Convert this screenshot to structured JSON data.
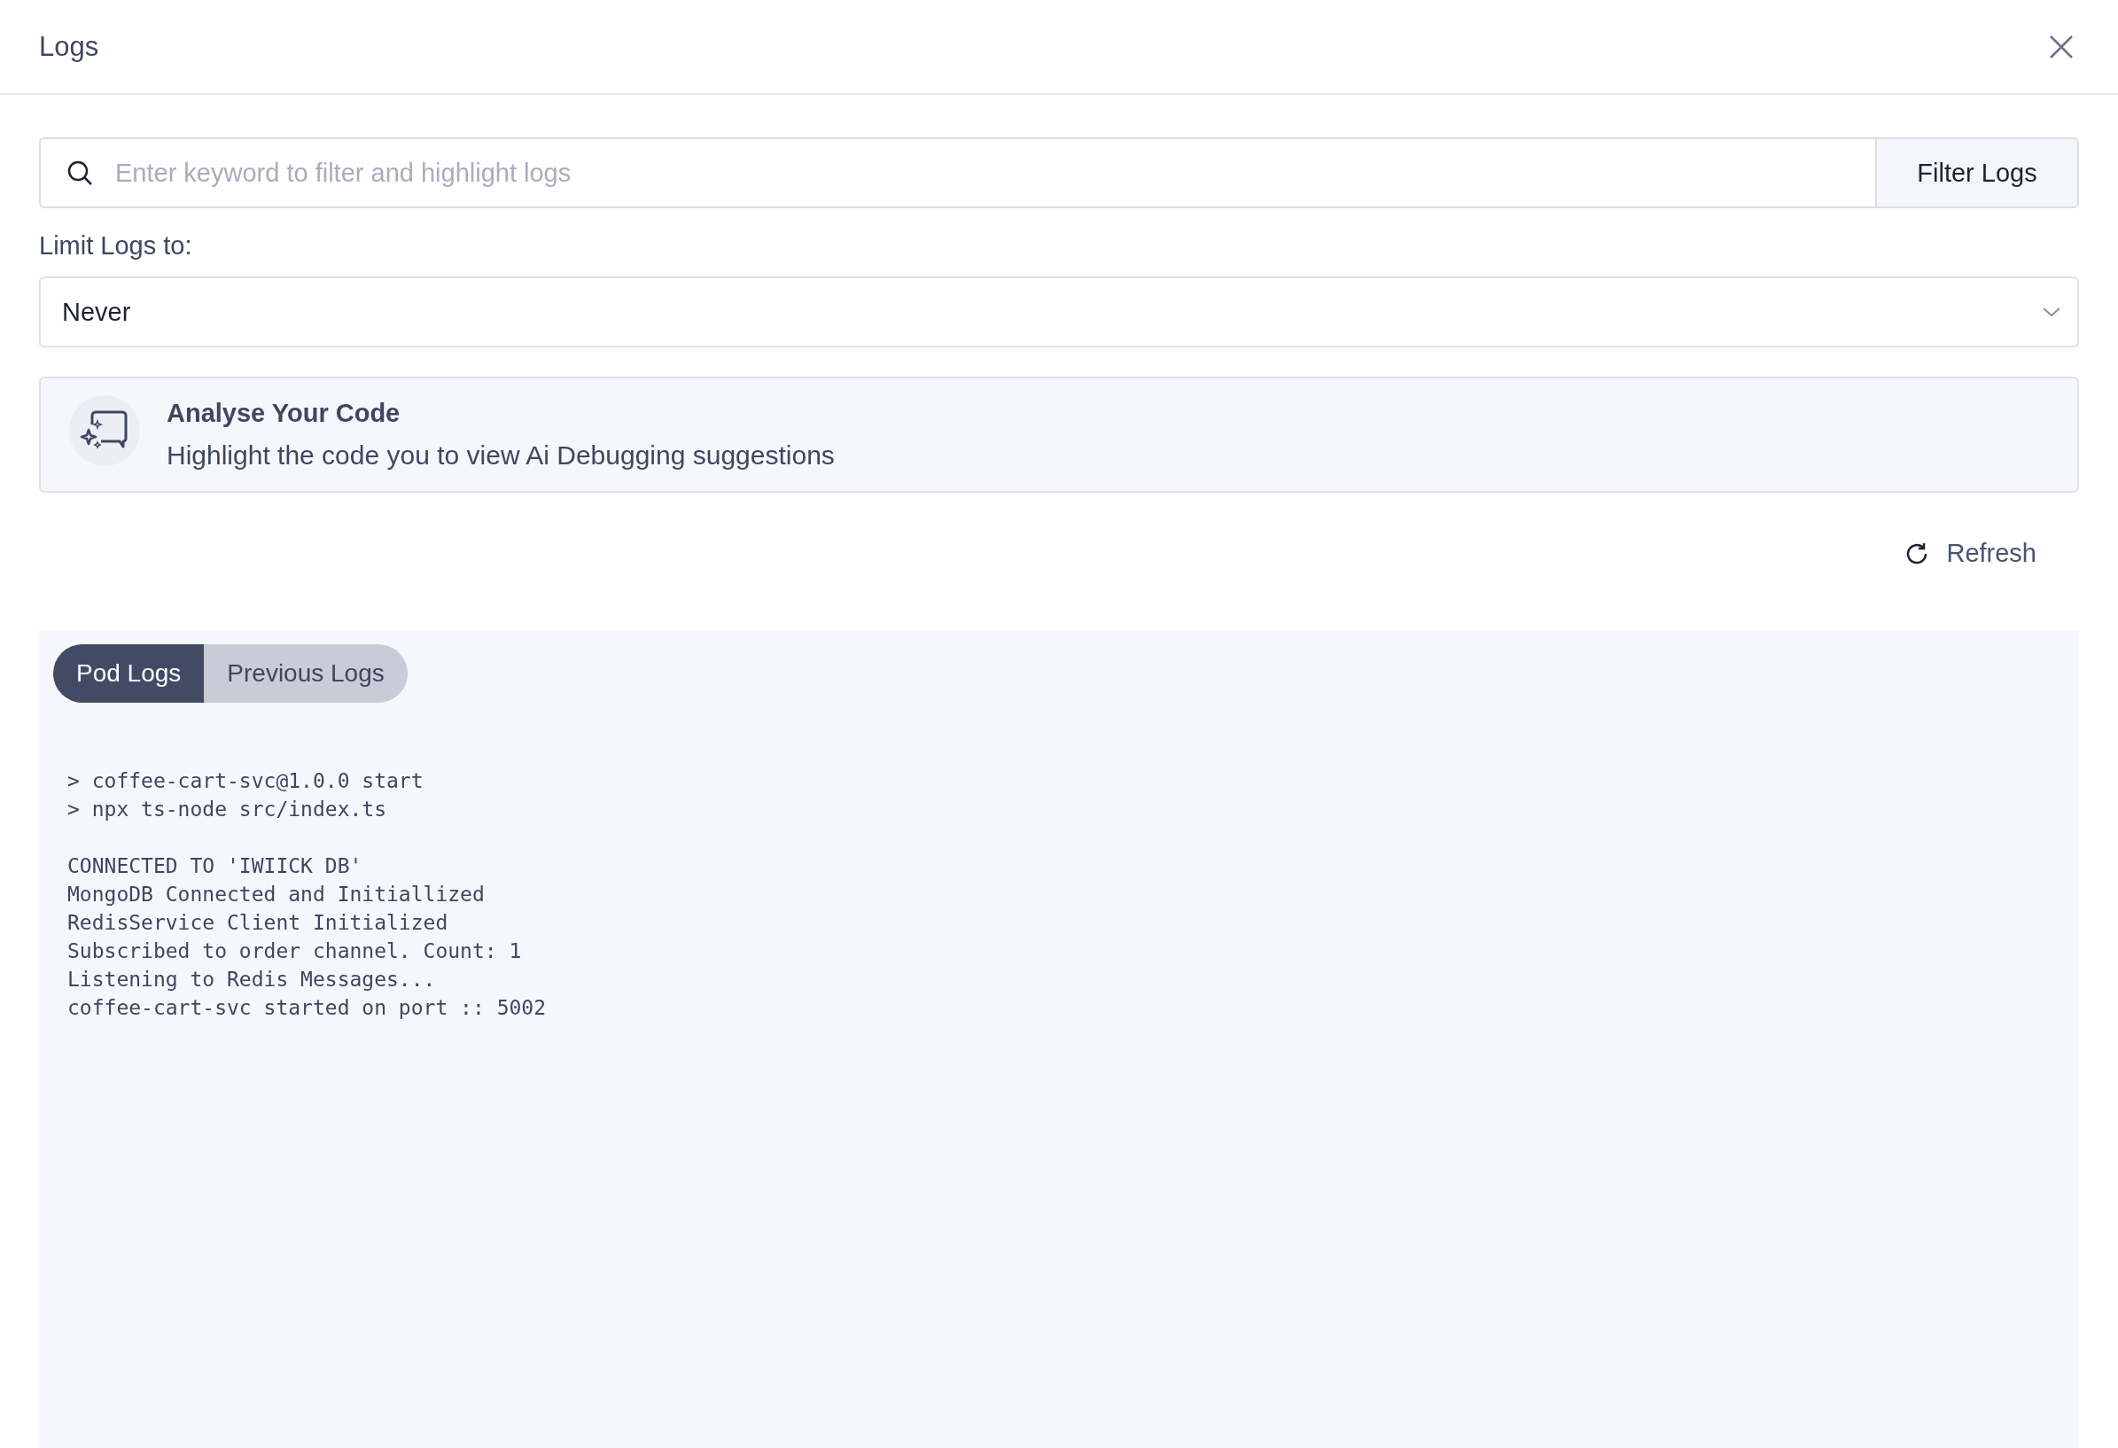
{
  "dialog": {
    "title": "Logs"
  },
  "search": {
    "placeholder": "Enter keyword to filter and highlight logs",
    "button": "Filter Logs"
  },
  "limit": {
    "label": "Limit Logs to:",
    "value": "Never"
  },
  "analyse_card": {
    "title": "Analyse Your Code",
    "text": "Highlight the code you to view Ai Debugging suggestions"
  },
  "refresh": "Refresh",
  "tabs": [
    {
      "label": "Pod Logs",
      "selected": true
    },
    {
      "label": "Previous Logs",
      "selected": false
    }
  ],
  "log_groups": [
    {
      "lines": [
        "> coffee-cart-svc@1.0.0 start",
        "> npx ts-node src/index.ts"
      ]
    },
    {
      "lines": [
        "CONNECTED TO 'IWIICK DB'",
        "MongoDB Connected and Initiallized",
        "RedisService Client Initialized",
        "Subscribed to order channel. Count: 1",
        "Listening to Redis Messages...",
        "coffee-cart-svc started on port :: 5002"
      ]
    }
  ]
}
